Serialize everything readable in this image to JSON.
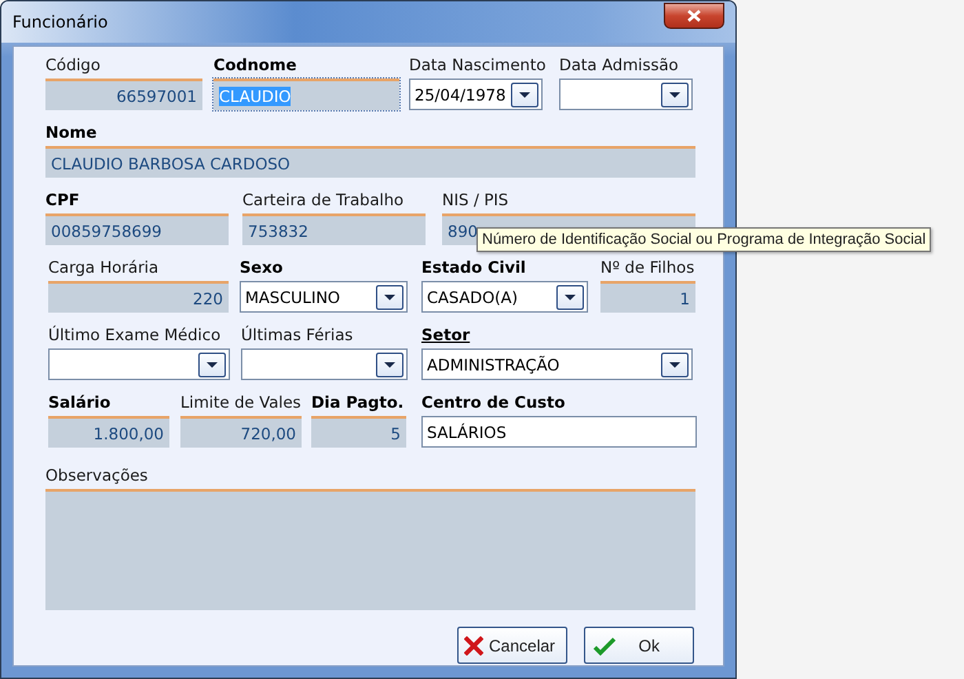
{
  "window": {
    "title": "Funcionário"
  },
  "rows": [
    {
      "fields": [
        {
          "label": "Código",
          "bold": false,
          "underlined": false,
          "kind": "number",
          "value": "66597001",
          "selected": false
        },
        {
          "label": "Codnome",
          "bold": true,
          "underlined": false,
          "kind": "readonly",
          "value": "CLAUDIO",
          "selected": true
        },
        {
          "label": "Data Nascimento",
          "bold": false,
          "underlined": false,
          "kind": "combo",
          "value": "25/04/1978",
          "selected": false
        },
        {
          "label": "Data Admissão",
          "bold": false,
          "underlined": false,
          "kind": "combo",
          "selected": false
        }
      ]
    },
    {
      "fields": [
        {
          "label": "Nome",
          "bold": true,
          "underlined": false,
          "kind": "readonly",
          "value": "CLAUDIO BARBOSA CARDOSO",
          "selected": false
        }
      ]
    },
    {
      "fields": [
        {
          "label": "CPF",
          "bold": true,
          "underlined": false,
          "kind": "readonly",
          "value": "00859758699",
          "selected": false
        },
        {
          "label": "Carteira de Trabalho",
          "bold": false,
          "underlined": false,
          "kind": "readonly",
          "value": "753832",
          "selected": false
        },
        {
          "label": "NIS / PIS",
          "bold": false,
          "underlined": false,
          "kind": "readonly",
          "value": "890",
          "selected": false
        }
      ]
    },
    {
      "fields": [
        {
          "label": "Carga Horária",
          "bold": false,
          "underlined": false,
          "kind": "number",
          "value": "220",
          "selected": false
        },
        {
          "label": "Sexo",
          "bold": true,
          "underlined": false,
          "kind": "combo",
          "value": "MASCULINO",
          "selected": false
        },
        {
          "label": "Estado Civil",
          "bold": true,
          "underlined": false,
          "kind": "combo",
          "value": "CASADO(A)",
          "selected": false
        },
        {
          "label": "Nº de Filhos",
          "bold": false,
          "underlined": false,
          "kind": "number",
          "value": "1",
          "selected": false
        }
      ]
    },
    {
      "fields": [
        {
          "label": "Último Exame Médico",
          "bold": false,
          "underlined": false,
          "kind": "combo",
          "selected": false
        },
        {
          "label": "Últimas Férias",
          "bold": false,
          "underlined": false,
          "kind": "combo",
          "selected": false
        },
        {
          "label": "Setor",
          "bold": true,
          "underlined": true,
          "kind": "combo",
          "value": "ADMINISTRAÇÃO",
          "selected": false
        }
      ]
    },
    {
      "fields": [
        {
          "label": "Salário",
          "bold": true,
          "underlined": false,
          "kind": "number",
          "value": "1.800,00",
          "selected": false
        },
        {
          "label": "Limite de Vales",
          "bold": false,
          "underlined": false,
          "kind": "number",
          "value": "720,00",
          "selected": false
        },
        {
          "label": "Dia Pagto.",
          "bold": true,
          "underlined": false,
          "kind": "number",
          "value": "5",
          "selected": false
        },
        {
          "label": "Centro de Custo",
          "bold": true,
          "underlined": false,
          "kind": "text",
          "value": "SALÁRIOS",
          "selected": false
        }
      ]
    }
  ],
  "notes": {
    "label": "Observações"
  },
  "tooltip": "Número de Identificação Social ou Programa de Integração Social",
  "buttons": [
    {
      "kind": "cancel",
      "label": "Cancelar"
    },
    {
      "kind": "ok",
      "label": "Ok"
    }
  ]
}
